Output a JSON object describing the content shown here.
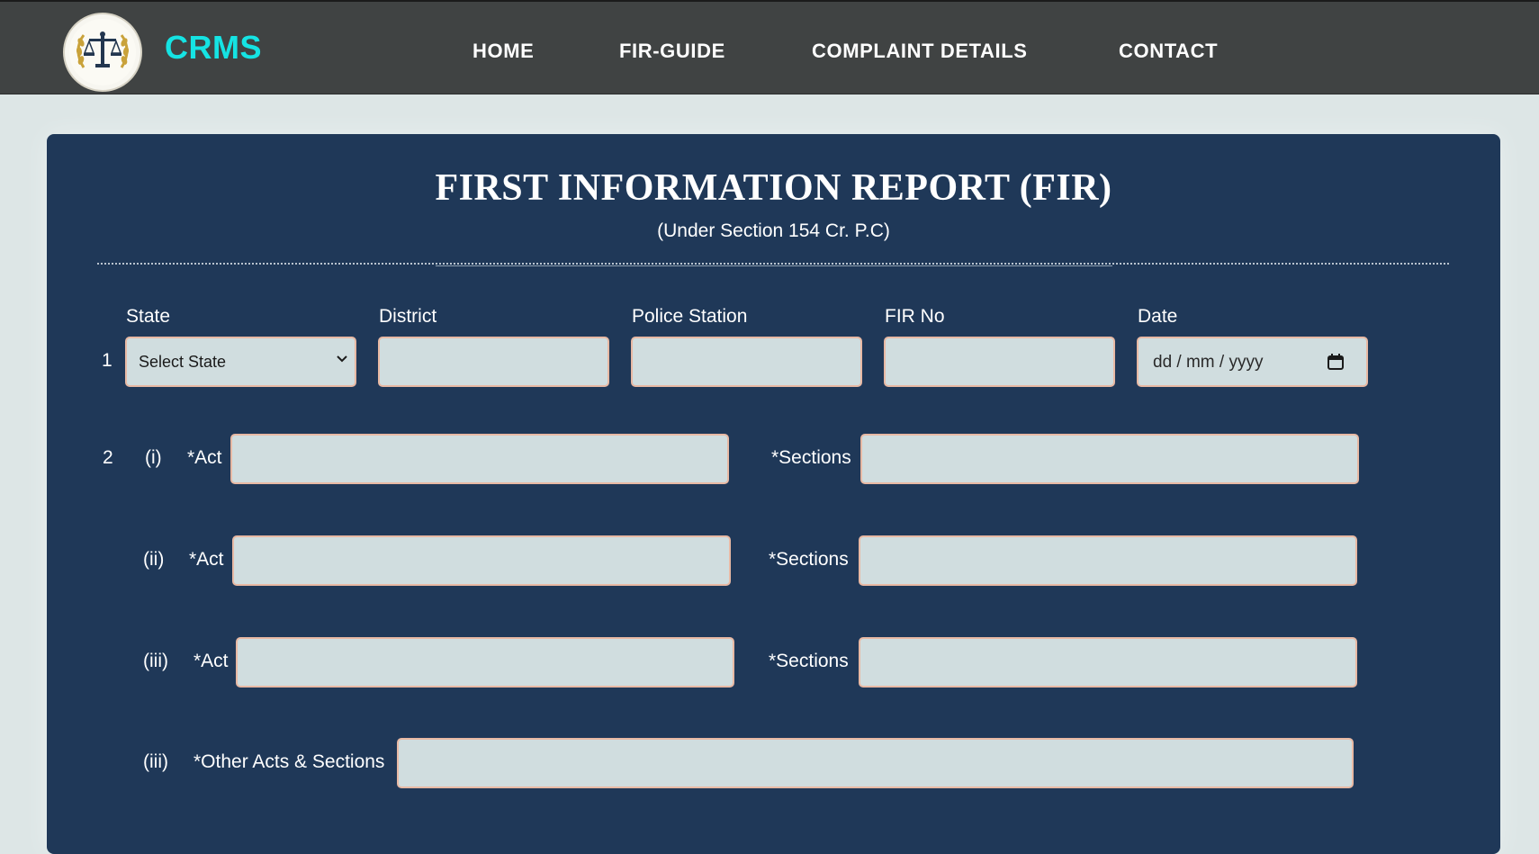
{
  "header": {
    "brand": "CRMS",
    "nav": [
      "HOME",
      "FIR-GUIDE",
      "COMPLAINT DETAILS",
      "CONTACT"
    ]
  },
  "form": {
    "title": "FIRST INFORMATION REPORT (FIR)",
    "subtitle": "(Under Section 154 Cr. P.C)",
    "row1": {
      "number": "1",
      "state_label": "State",
      "state_value": "Select State",
      "district_label": "District",
      "district_value": "",
      "police_station_label": "Police Station",
      "police_station_value": "",
      "fir_no_label": "FIR No",
      "fir_no_value": "",
      "date_label": "Date",
      "date_placeholder": "dd / mm / yyyy"
    },
    "row2": {
      "number": "2",
      "items": [
        {
          "roman": "(i)",
          "act_label": "*Act",
          "act_value": "",
          "sections_label": "*Sections",
          "sections_value": ""
        },
        {
          "roman": "(ii)",
          "act_label": "*Act",
          "act_value": "",
          "sections_label": "*Sections",
          "sections_value": ""
        },
        {
          "roman": "(iii)",
          "act_label": "*Act",
          "act_value": "",
          "sections_label": "*Sections",
          "sections_value": ""
        }
      ],
      "other": {
        "roman": "(iii)",
        "label": "*Other Acts & Sections",
        "value": ""
      }
    }
  },
  "colors": {
    "topbar": "#404343",
    "brand": "#15e3e3",
    "panel": "#1f3858",
    "field_bg": "#d0dddf",
    "field_border": "#e8b9a4",
    "page_bg": "#dde6e6"
  },
  "icons": {
    "logo": "scales-of-justice-emblem",
    "select_arrow": "chevron-down-icon",
    "date_picker": "calendar-icon"
  }
}
